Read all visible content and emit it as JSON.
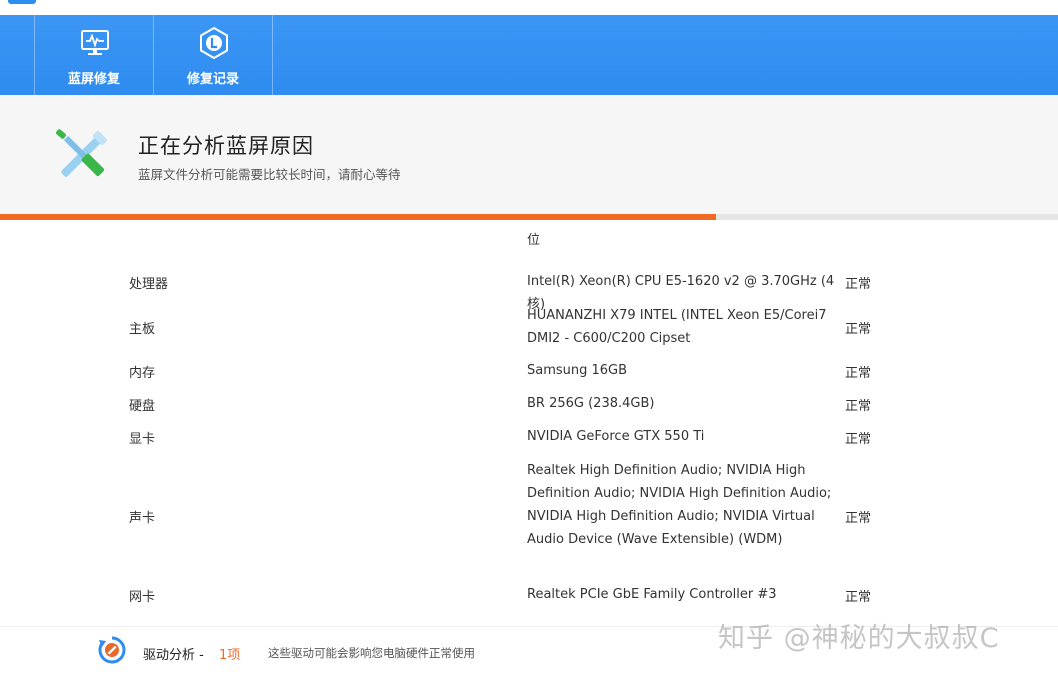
{
  "nav": {
    "items": [
      {
        "label": "蓝屏修复",
        "icon": "monitor-heartbeat-icon"
      },
      {
        "label": "修复记录",
        "icon": "hexagon-l-icon"
      }
    ]
  },
  "header": {
    "title": "正在分析蓝屏原因",
    "subtitle": "蓝屏文件分析可能需要比较长时间，请耐心等待",
    "icon": "tools-icon"
  },
  "progress": {
    "value": 0.677,
    "color": "#f06a24"
  },
  "hardware": {
    "partial_value": "位",
    "rows": [
      {
        "name": "处理器",
        "value": "Intel(R) Xeon(R) CPU E5-1620 v2 @ 3.70GHz (4核)",
        "status": "正常"
      },
      {
        "name": "主板",
        "value": "HUANANZHI X79 INTEL (INTEL Xeon E5/Corei7 DMI2 - C600/C200 Cipset",
        "status": "正常"
      },
      {
        "name": "内存",
        "value": "Samsung 16GB",
        "status": "正常"
      },
      {
        "name": "硬盘",
        "value": "BR 256G (238.4GB)",
        "status": "正常"
      },
      {
        "name": "显卡",
        "value": "NVIDIA GeForce GTX 550 Ti",
        "status": "正常"
      },
      {
        "name": "声卡",
        "value": "Realtek High Definition Audio; NVIDIA High Definition Audio; NVIDIA High Definition Audio; NVIDIA High Definition Audio; NVIDIA Virtual Audio Device (Wave Extensible) (WDM)",
        "status": "正常"
      },
      {
        "name": "网卡",
        "value": "Realtek PCIe GbE Family Controller #3",
        "status": "正常"
      }
    ]
  },
  "footer": {
    "label": "驱动分析 -",
    "count": "1项",
    "desc": "这些驱动可能会影响您电脑硬件正常使用",
    "icon": "refresh-wrench-icon"
  },
  "watermark": "知乎 @神秘的大叔叔C",
  "colors": {
    "accent": "#2f8cf0",
    "progress": "#f06a24"
  }
}
